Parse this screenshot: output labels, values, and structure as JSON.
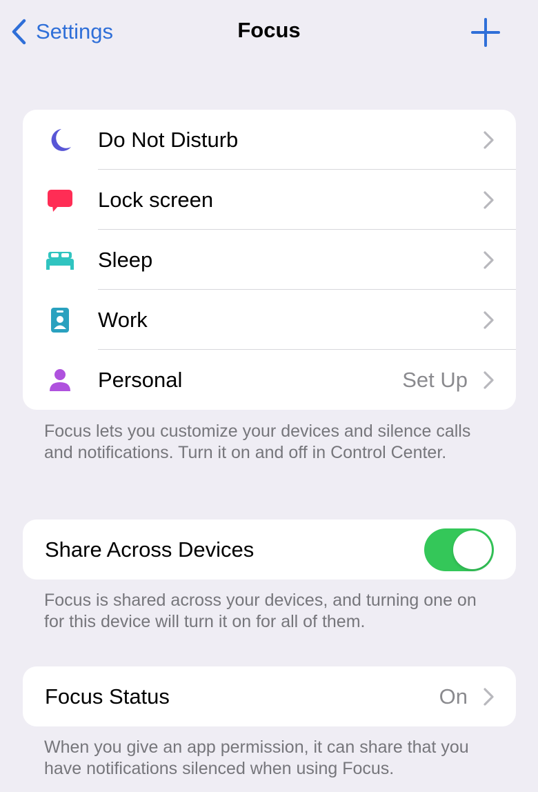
{
  "nav": {
    "back_label": "Settings",
    "title": "Focus",
    "add_icon": "plus-icon"
  },
  "focus_modes": [
    {
      "label": "Do Not Disturb",
      "icon": "moon-icon",
      "color": "#5856d6",
      "value": ""
    },
    {
      "label": "Lock screen",
      "icon": "speech-bubble-icon",
      "color": "#ff2d55",
      "value": ""
    },
    {
      "label": "Sleep",
      "icon": "bed-icon",
      "color": "#30c4c0",
      "value": ""
    },
    {
      "label": "Work",
      "icon": "id-badge-icon",
      "color": "#2aa1bf",
      "value": ""
    },
    {
      "label": "Personal",
      "icon": "person-icon",
      "color": "#af52de",
      "value": "Set Up"
    }
  ],
  "focus_footer": "Focus lets you customize your devices and silence calls and notifications. Turn it on and off in Control Center.",
  "share": {
    "label": "Share Across Devices",
    "enabled": true,
    "footer": "Focus is shared across your devices, and turning one on for this device will turn it on for all of them."
  },
  "status": {
    "label": "Focus Status",
    "value": "On",
    "footer": "When you give an app permission, it can share that you have notifications silenced when using Focus."
  },
  "colors": {
    "accent": "#2f6fd8",
    "toggle_on": "#34c759"
  }
}
